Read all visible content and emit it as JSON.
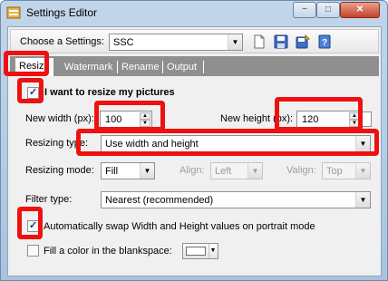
{
  "window": {
    "title": "Settings Editor",
    "min_glyph": "−",
    "max_glyph": "□",
    "close_glyph": "✕"
  },
  "toolbar": {
    "choose_label": "Choose a Settings:",
    "settings_value": "SSC",
    "icons": [
      "new-document-icon",
      "save-icon",
      "save-as-icon",
      "help-icon"
    ]
  },
  "tabs": [
    {
      "label": "Resize",
      "active": true
    },
    {
      "label": "Watermark",
      "active": false
    },
    {
      "label": "Rename",
      "active": false
    },
    {
      "label": "Output",
      "active": false
    }
  ],
  "resize": {
    "enable_label": "I want to resize my pictures",
    "enable_checked": true,
    "width_label": "New width (px):",
    "width_value": "100",
    "height_label": "New height (px):",
    "height_value": "120",
    "type_label": "Resizing type:",
    "type_value": "Use width and height",
    "mode_label": "Resizing mode:",
    "mode_value": "Fill",
    "align_label": "Align:",
    "align_value": "Left",
    "valign_label": "Valign:",
    "valign_value": "Top",
    "filter_label": "Filter type:",
    "filter_value": "Nearest (recommended)",
    "swap_label": "Automatically swap Width and Height values on portrait mode",
    "swap_checked": true,
    "fill_label": "Fill a color in the blankspace:",
    "fill_checked": false,
    "fill_color": "#ffffff"
  },
  "colors": {
    "highlight": "#ee1111",
    "tab_bar": "#8f8f8f"
  }
}
